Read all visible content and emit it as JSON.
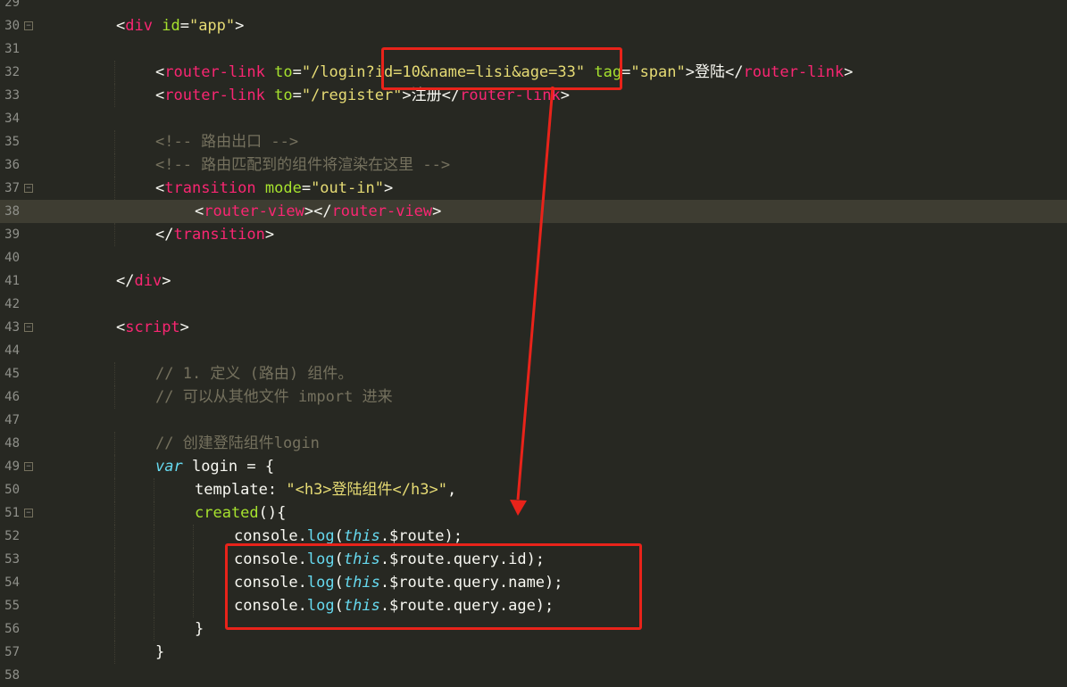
{
  "lines": [
    {
      "n": "29",
      "fold": false,
      "indent": 0,
      "tokens": []
    },
    {
      "n": "30",
      "fold": true,
      "indent": 2,
      "tokens": [
        [
          "t-plain",
          "<"
        ],
        [
          "t-tag",
          "div"
        ],
        [
          "t-plain",
          " "
        ],
        [
          "t-attr",
          "id"
        ],
        [
          "t-plain",
          "="
        ],
        [
          "t-str",
          "\"app\""
        ],
        [
          "t-plain",
          ">"
        ]
      ]
    },
    {
      "n": "31",
      "fold": false,
      "indent": 0,
      "tokens": []
    },
    {
      "n": "32",
      "fold": false,
      "indent": 3,
      "tokens": [
        [
          "t-plain",
          "<"
        ],
        [
          "t-tag",
          "router-link"
        ],
        [
          "t-plain",
          " "
        ],
        [
          "t-attr",
          "to"
        ],
        [
          "t-plain",
          "="
        ],
        [
          "t-str",
          "\"/login?id=10&name=lisi&age=33\""
        ],
        [
          "t-plain",
          " "
        ],
        [
          "t-attr",
          "tag"
        ],
        [
          "t-plain",
          "="
        ],
        [
          "t-str",
          "\"span\""
        ],
        [
          "t-plain",
          ">登陆</"
        ],
        [
          "t-tag",
          "router-link"
        ],
        [
          "t-plain",
          ">"
        ]
      ]
    },
    {
      "n": "33",
      "fold": false,
      "indent": 3,
      "tokens": [
        [
          "t-plain",
          "<"
        ],
        [
          "t-tag",
          "router-link"
        ],
        [
          "t-plain",
          " "
        ],
        [
          "t-attr",
          "to"
        ],
        [
          "t-plain",
          "="
        ],
        [
          "t-str",
          "\"/register\""
        ],
        [
          "t-plain",
          ">注册</"
        ],
        [
          "t-tag",
          "router-link"
        ],
        [
          "t-plain",
          ">"
        ]
      ]
    },
    {
      "n": "34",
      "fold": false,
      "indent": 0,
      "tokens": []
    },
    {
      "n": "35",
      "fold": false,
      "indent": 3,
      "tokens": [
        [
          "t-cmt",
          "<!-- 路由出口 -->"
        ]
      ]
    },
    {
      "n": "36",
      "fold": false,
      "indent": 3,
      "tokens": [
        [
          "t-cmt",
          "<!-- 路由匹配到的组件将渲染在这里 -->"
        ]
      ]
    },
    {
      "n": "37",
      "fold": true,
      "indent": 3,
      "tokens": [
        [
          "t-plain",
          "<"
        ],
        [
          "t-tag",
          "transition"
        ],
        [
          "t-plain",
          " "
        ],
        [
          "t-attr",
          "mode"
        ],
        [
          "t-plain",
          "="
        ],
        [
          "t-str",
          "\"out-in\""
        ],
        [
          "t-plain",
          ">"
        ]
      ]
    },
    {
      "n": "38",
      "fold": false,
      "indent": 4,
      "current": true,
      "tokens": [
        [
          "t-plain",
          "<"
        ],
        [
          "t-tag",
          "router-view"
        ],
        [
          "t-plain",
          "></"
        ],
        [
          "t-tag",
          "router-view"
        ],
        [
          "t-plain",
          ">"
        ]
      ]
    },
    {
      "n": "39",
      "fold": false,
      "indent": 3,
      "tokens": [
        [
          "t-plain",
          "</"
        ],
        [
          "t-tag",
          "transition"
        ],
        [
          "t-plain",
          ">"
        ]
      ]
    },
    {
      "n": "40",
      "fold": false,
      "indent": 0,
      "tokens": []
    },
    {
      "n": "41",
      "fold": false,
      "indent": 2,
      "tokens": [
        [
          "t-plain",
          "</"
        ],
        [
          "t-tag",
          "div"
        ],
        [
          "t-plain",
          ">"
        ]
      ]
    },
    {
      "n": "42",
      "fold": false,
      "indent": 0,
      "tokens": []
    },
    {
      "n": "43",
      "fold": true,
      "indent": 2,
      "tokens": [
        [
          "t-plain",
          "<"
        ],
        [
          "t-tag",
          "script"
        ],
        [
          "t-plain",
          ">"
        ]
      ]
    },
    {
      "n": "44",
      "fold": false,
      "indent": 0,
      "tokens": []
    },
    {
      "n": "45",
      "fold": false,
      "indent": 3,
      "tokens": [
        [
          "t-cmt",
          "// 1. 定义 (路由) 组件。"
        ]
      ]
    },
    {
      "n": "46",
      "fold": false,
      "indent": 3,
      "tokens": [
        [
          "t-cmt",
          "// 可以从其他文件 import 进来"
        ]
      ]
    },
    {
      "n": "47",
      "fold": false,
      "indent": 0,
      "tokens": []
    },
    {
      "n": "48",
      "fold": false,
      "indent": 3,
      "tokens": [
        [
          "t-cmt",
          "// 创建登陆组件login"
        ]
      ]
    },
    {
      "n": "49",
      "fold": true,
      "indent": 3,
      "tokens": [
        [
          "t-kw",
          "var"
        ],
        [
          "t-plain",
          " login = {"
        ]
      ]
    },
    {
      "n": "50",
      "fold": false,
      "indent": 4,
      "tokens": [
        [
          "t-plain",
          "template: "
        ],
        [
          "t-str",
          "\"<h3>登陆组件</h3>\""
        ],
        [
          "t-plain",
          ","
        ]
      ]
    },
    {
      "n": "51",
      "fold": true,
      "indent": 4,
      "tokens": [
        [
          "t-fn",
          "created"
        ],
        [
          "t-plain",
          "(){"
        ]
      ]
    },
    {
      "n": "52",
      "fold": false,
      "indent": 5,
      "tokens": [
        [
          "t-plain",
          "console."
        ],
        [
          "t-log",
          "log"
        ],
        [
          "t-plain",
          "("
        ],
        [
          "t-this",
          "this"
        ],
        [
          "t-plain",
          ".$route);"
        ]
      ]
    },
    {
      "n": "53",
      "fold": false,
      "indent": 5,
      "tokens": [
        [
          "t-plain",
          "console."
        ],
        [
          "t-log",
          "log"
        ],
        [
          "t-plain",
          "("
        ],
        [
          "t-this",
          "this"
        ],
        [
          "t-plain",
          ".$route.query.id);"
        ]
      ]
    },
    {
      "n": "54",
      "fold": false,
      "indent": 5,
      "tokens": [
        [
          "t-plain",
          "console."
        ],
        [
          "t-log",
          "log"
        ],
        [
          "t-plain",
          "("
        ],
        [
          "t-this",
          "this"
        ],
        [
          "t-plain",
          ".$route.query.name);"
        ]
      ]
    },
    {
      "n": "55",
      "fold": false,
      "indent": 5,
      "tokens": [
        [
          "t-plain",
          "console."
        ],
        [
          "t-log",
          "log"
        ],
        [
          "t-plain",
          "("
        ],
        [
          "t-this",
          "this"
        ],
        [
          "t-plain",
          ".$route.query.age);"
        ]
      ]
    },
    {
      "n": "56",
      "fold": false,
      "indent": 4,
      "tokens": [
        [
          "t-plain",
          "}"
        ]
      ]
    },
    {
      "n": "57",
      "fold": false,
      "indent": 3,
      "tokens": [
        [
          "t-plain",
          "}"
        ]
      ]
    },
    {
      "n": "58",
      "fold": false,
      "indent": 0,
      "tokens": []
    }
  ],
  "colors": {
    "background": "#272822",
    "annotation": "#e8231a"
  },
  "fold_glyph": "⊟"
}
